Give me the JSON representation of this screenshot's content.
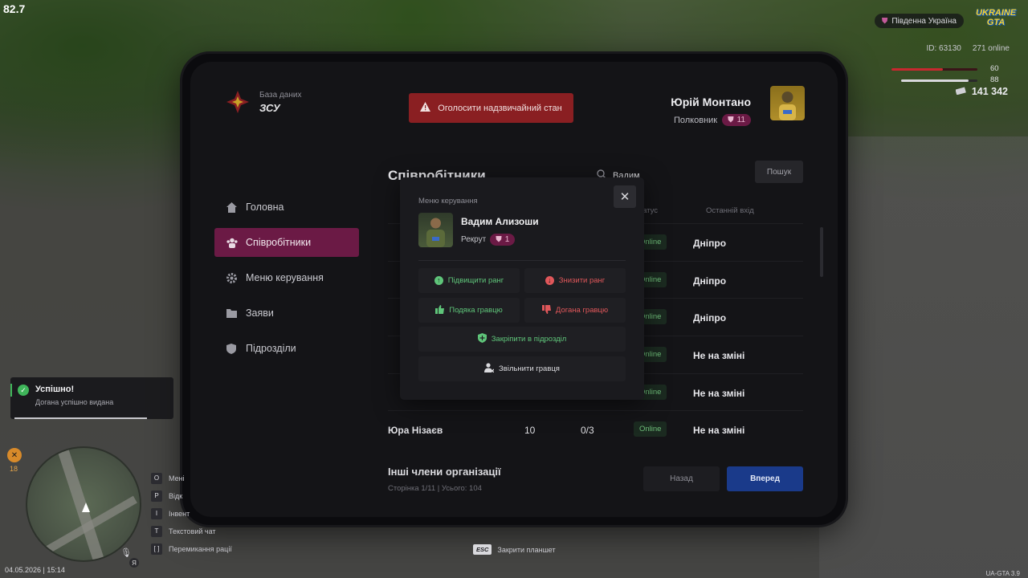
{
  "fps": "82.7",
  "tablet": {
    "brand": {
      "sub": "База даних",
      "title": "ЗСУ"
    },
    "alert_button": "Оголосити надзвичайний стан",
    "user": {
      "name": "Юрій Монтано",
      "rank": "Полковник",
      "rank_level": "11"
    },
    "sidebar": [
      {
        "label": "Головна",
        "icon": "home-icon"
      },
      {
        "label": "Співробітники",
        "icon": "users-icon",
        "active": true
      },
      {
        "label": "Меню керування",
        "icon": "gear-icon"
      },
      {
        "label": "Заяви",
        "icon": "folder-icon"
      },
      {
        "label": "Підрозділи",
        "icon": "shield-icon"
      }
    ],
    "main": {
      "title": "Співробітники",
      "search_value": "Вадим",
      "search_button": "Пошук",
      "columns": {
        "status": "Статус",
        "last_login": "Останній вхід"
      },
      "rows": [
        {
          "name": "",
          "level": "",
          "warnings": "",
          "status": "Online",
          "last": "Дніпро"
        },
        {
          "name": "",
          "level": "",
          "warnings": "",
          "status": "Online",
          "last": "Дніпро"
        },
        {
          "name": "",
          "level": "",
          "warnings": "",
          "status": "Online",
          "last": "Дніпро"
        },
        {
          "name": "",
          "level": "",
          "warnings": "",
          "status": "Online",
          "last": "Не на зміні"
        },
        {
          "name": "",
          "level": "",
          "warnings": "",
          "status": "Online",
          "last": "Не на зміні"
        },
        {
          "name": "Юра Нізаєв",
          "level": "10",
          "warnings": "0/3",
          "status": "Online",
          "last": "Не на зміні"
        }
      ],
      "others": {
        "title": "Інші члени організації",
        "meta": "Сторінка 1/11 | Усього: 104"
      },
      "back_button": "Назад",
      "next_button": "Вперед"
    },
    "modal": {
      "subtitle": "Меню керування",
      "employee": {
        "name": "Вадим Ализоши",
        "rank": "Рекрут",
        "rank_level": "1"
      },
      "buttons": {
        "promote": "Підвищити ранг",
        "demote": "Знизити ранг",
        "thanks": "Подяка гравцю",
        "reprimand": "Догана гравцю",
        "assign": "Закріпити в підрозділ",
        "fire": "Звільнити гравця"
      }
    }
  },
  "hud": {
    "server": "Південна Україна",
    "logo": "UKRAINE GTA",
    "id": "ID: 63130",
    "online": "271 online",
    "health": "60",
    "armor": "88",
    "health_fraction": 0.6,
    "armor_fraction": 0.88,
    "money": "141 342",
    "tool_count": "18",
    "datetime": "04.05.2026 | 15:14",
    "ya": "Я",
    "version": "UA-GTA 3.9",
    "keyhints": [
      {
        "key": "O",
        "label": "Мені"
      },
      {
        "key": "P",
        "label": "Відк"
      },
      {
        "key": "I",
        "label": "Інвент"
      },
      {
        "key": "T",
        "label": "Текстовий чат"
      },
      {
        "key": "[ ]",
        "label": "Перемикання рації"
      }
    ],
    "esc_key": "ESC",
    "esc_label": "Закрити планшет"
  },
  "notification": {
    "title": "Успішно!",
    "text": "Догана успішно видана"
  },
  "colors": {
    "accent": "#6b1a45",
    "alert": "#8a1f22",
    "next": "#1a3a8a",
    "online": "#6fbf7a"
  }
}
